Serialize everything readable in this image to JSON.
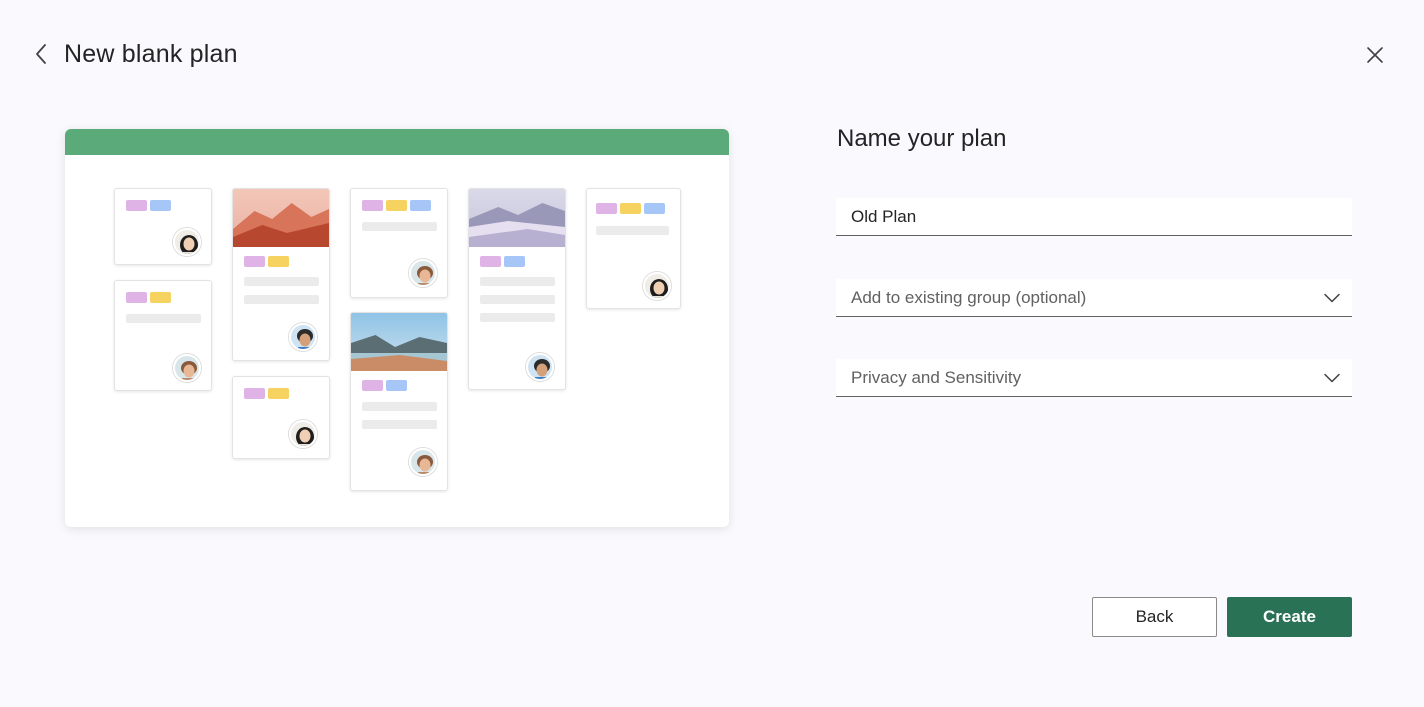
{
  "header": {
    "title": "New blank plan",
    "back_icon": "chevron-left-icon",
    "close_icon": "close-icon"
  },
  "form": {
    "section_title": "Name your plan",
    "plan_name_value": "Old Plan",
    "group_select_placeholder": "Add to existing group (optional)",
    "privacy_select_placeholder": "Privacy and Sensitivity"
  },
  "buttons": {
    "back_label": "Back",
    "create_label": "Create"
  },
  "colors": {
    "accent_green": "#2a7255",
    "preview_bar_green": "#5aab79",
    "background": "#faf9fd"
  }
}
